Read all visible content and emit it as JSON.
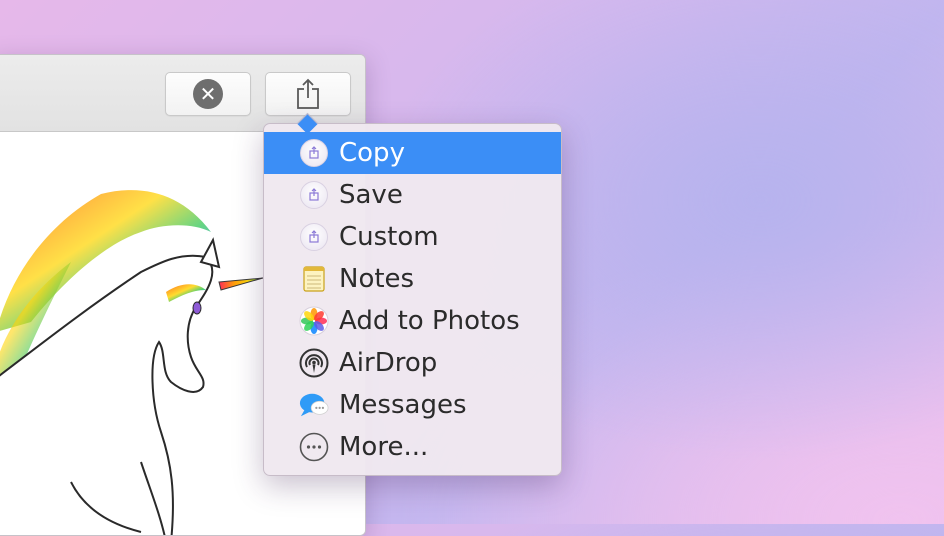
{
  "toolbar": {
    "close_label": "✕",
    "share_label": "Share"
  },
  "menu": {
    "items": [
      {
        "label": "Copy",
        "icon": "extension-icon",
        "selected": true
      },
      {
        "label": "Save",
        "icon": "extension-icon"
      },
      {
        "label": "Custom",
        "icon": "extension-icon"
      },
      {
        "label": "Notes",
        "icon": "notes-icon"
      },
      {
        "label": "Add to Photos",
        "icon": "photos-icon"
      },
      {
        "label": "AirDrop",
        "icon": "airdrop-icon"
      },
      {
        "label": "Messages",
        "icon": "messages-icon"
      },
      {
        "label": "More...",
        "icon": "more-icon"
      }
    ]
  },
  "colors": {
    "selection": "#3b8ef6",
    "menu_text": "#2b2b2b"
  }
}
